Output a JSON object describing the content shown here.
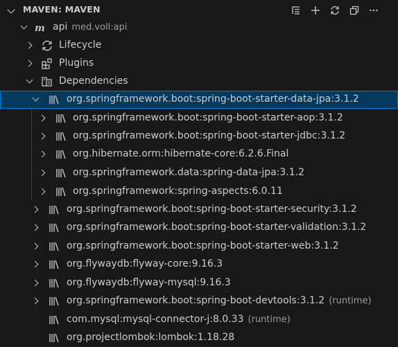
{
  "header": {
    "title": "MAVEN: MAVEN",
    "actions": [
      "collapse-all-icon",
      "add-icon",
      "refresh-icon",
      "explorer-icon",
      "more-icon"
    ]
  },
  "tree": {
    "project": {
      "label": "api",
      "description": "med.voll:api"
    },
    "lifecycle": "Lifecycle",
    "plugins": "Plugins",
    "dependencies": "Dependencies",
    "items": [
      {
        "label": "org.springframework.boot:spring-boot-starter-data-jpa:3.1.2",
        "desc": ""
      },
      {
        "label": "org.springframework.boot:spring-boot-starter-aop:3.1.2",
        "desc": ""
      },
      {
        "label": "org.springframework.boot:spring-boot-starter-jdbc:3.1.2",
        "desc": ""
      },
      {
        "label": "org.hibernate.orm:hibernate-core:6.2.6.Final",
        "desc": ""
      },
      {
        "label": "org.springframework.data:spring-data-jpa:3.1.2",
        "desc": ""
      },
      {
        "label": "org.springframework:spring-aspects:6.0.11",
        "desc": ""
      },
      {
        "label": "org.springframework.boot:spring-boot-starter-security:3.1.2",
        "desc": ""
      },
      {
        "label": "org.springframework.boot:spring-boot-starter-validation:3.1.2",
        "desc": ""
      },
      {
        "label": "org.springframework.boot:spring-boot-starter-web:3.1.2",
        "desc": ""
      },
      {
        "label": "org.flywaydb:flyway-core:9.16.3",
        "desc": ""
      },
      {
        "label": "org.flywaydb:flyway-mysql:9.16.3",
        "desc": ""
      },
      {
        "label": "org.springframework.boot:spring-boot-devtools:3.1.2",
        "desc": "(runtime)"
      },
      {
        "label": "com.mysql:mysql-connector-j:8.0.33",
        "desc": "(runtime)"
      },
      {
        "label": "org.projectlombok:lombok:1.18.28",
        "desc": ""
      }
    ]
  }
}
